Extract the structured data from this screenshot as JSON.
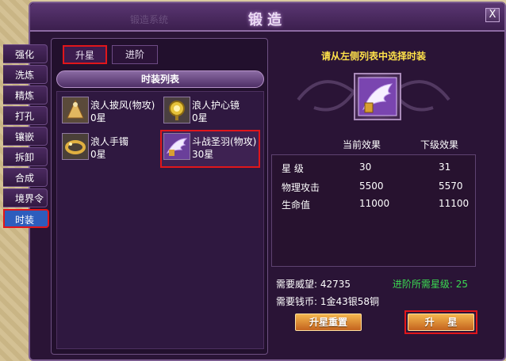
{
  "window": {
    "title": "锻造",
    "faded_title": "锻造系统",
    "close_label": "X"
  },
  "side_tabs": [
    {
      "label": "强化",
      "active": false
    },
    {
      "label": "洗炼",
      "active": false
    },
    {
      "label": "精炼",
      "active": false
    },
    {
      "label": "打孔",
      "active": false
    },
    {
      "label": "镶嵌",
      "active": false
    },
    {
      "label": "拆卸",
      "active": false
    },
    {
      "label": "合成",
      "active": false
    },
    {
      "label": "境界令",
      "active": false
    },
    {
      "label": "时装",
      "active": true
    }
  ],
  "tabs": {
    "upgrade": "升星",
    "advance": "进阶"
  },
  "list": {
    "header": "时装列表",
    "items": [
      {
        "name": "浪人披风(物攻)",
        "stars": "0星",
        "icon": "cape-icon"
      },
      {
        "name": "浪人护心镜",
        "stars": "0星",
        "icon": "mirror-icon"
      },
      {
        "name": "浪人手镯",
        "stars": "0星",
        "icon": "bracelet-icon"
      },
      {
        "name": "斗战圣羽(物攻)",
        "stars": "30星",
        "icon": "wing-icon",
        "selected": true
      }
    ]
  },
  "detail": {
    "prompt": "请从左侧列表中选择时装",
    "current_effect_label": "当前效果",
    "next_effect_label": "下级效果",
    "stats": [
      {
        "name": "星    级",
        "current": "30",
        "next": "31"
      },
      {
        "name": "物理攻击",
        "current": "5500",
        "next": "5570"
      },
      {
        "name": "生命值",
        "current": "11000",
        "next": "11100"
      }
    ],
    "prestige_label": "需要威望: 42735",
    "money_label": "需要钱币: 1金43银58铜",
    "advance_req_label": "进阶所需星级: 25",
    "reset_button": "升星重置",
    "star_button": "升    星"
  },
  "colors": {
    "accent_red": "#e0161b",
    "prompt_yellow": "#ffe24a",
    "req_green": "#3bdb52"
  }
}
